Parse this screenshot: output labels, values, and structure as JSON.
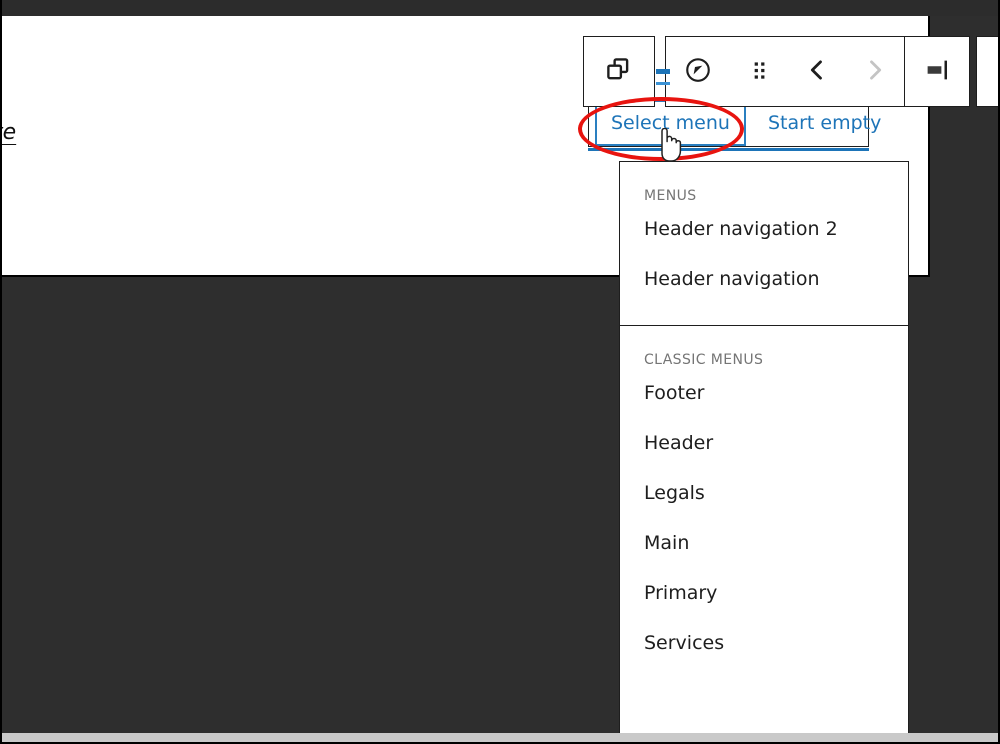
{
  "window": {
    "chrome_color": "#2e2e2e",
    "topbar_color": "#2c2c2c",
    "bottom_strip_color": "#c9c9c9"
  },
  "canvas": {
    "background": "#ffffff",
    "partial_link_text": "te"
  },
  "scrollbar": {
    "thumb_color": "#777777",
    "orientation": "vertical"
  },
  "toolbar": {
    "buttons": [
      {
        "name": "duplicate-blocks",
        "icon": "copy-blocks-icon",
        "label": "Select parent block",
        "disabled": false
      },
      {
        "name": "block-type",
        "icon": "navigation-compass-icon",
        "label": "Navigation",
        "disabled": false
      },
      {
        "name": "drag-handle",
        "icon": "drag-dots-icon",
        "label": "Drag",
        "disabled": false
      },
      {
        "name": "move-up",
        "icon": "chevron-left-icon",
        "label": "Move left",
        "disabled": false
      },
      {
        "name": "move-down",
        "icon": "chevron-right-icon",
        "label": "Move right",
        "disabled": true
      },
      {
        "name": "align",
        "icon": "align-right-icon",
        "label": "Align",
        "disabled": false
      },
      {
        "name": "justify-items",
        "icon": "justify-icon",
        "label": "Justify items",
        "disabled": false
      }
    ],
    "selection_accent": "#1d74b8"
  },
  "placeholder": {
    "select_menu_label": "Select menu",
    "start_empty_label": "Start empty",
    "focused_button": "Select menu",
    "link_color": "#1d74b8"
  },
  "dropdown": {
    "sections": [
      {
        "label": "MENUS",
        "items": [
          {
            "label": "Header navigation 2"
          },
          {
            "label": "Header navigation"
          }
        ]
      },
      {
        "label": "CLASSIC MENUS",
        "items": [
          {
            "label": "Footer"
          },
          {
            "label": "Header"
          },
          {
            "label": "Legals"
          },
          {
            "label": "Main"
          },
          {
            "label": "Primary"
          },
          {
            "label": "Services"
          }
        ]
      }
    ]
  },
  "annotation": {
    "shape": "ellipse",
    "color": "#e8140f",
    "targets": "Select menu"
  },
  "cursor": {
    "type": "pointer-hand"
  }
}
